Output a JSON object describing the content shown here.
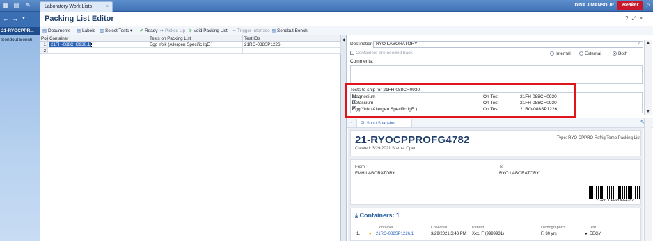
{
  "window": {
    "tab_title": "Laboratory Work Lists",
    "user": "DINA J MANSOUR",
    "brand": "Beaker"
  },
  "sidebar": {
    "active_item": "21-RYOCPPR...",
    "items": [
      "Sendout Bench"
    ]
  },
  "header": {
    "title": "Packing List Editor"
  },
  "toolbar": {
    "items": [
      "Documents",
      "Labels",
      "Select Tests",
      "Ready",
      "Picked Up",
      "Void Packing List",
      "Trigger Interface",
      "Sendout Bench"
    ]
  },
  "grid": {
    "columns": [
      "Pos",
      "Container",
      "Tests on Packing List",
      "Test IDs"
    ],
    "rows": [
      {
        "pos": "1",
        "container": "21FH-088CH0930.1",
        "tests": "Egg Yolk (Allergen Specific IgE )",
        "test_ids": "21RO-088SP1226"
      },
      {
        "pos": "2",
        "container": "",
        "tests": "",
        "test_ids": ""
      }
    ]
  },
  "destination": {
    "label": "Destination:",
    "value": "RYO LABORATORY",
    "containers_needed_back": "Containers are needed back",
    "radio_options": [
      "Internal",
      "External",
      "Both"
    ],
    "selected": "Both",
    "comments_label": "Comments:"
  },
  "tests_to_ship": {
    "title": "Tests to ship for 21FH-088CH0930",
    "rows": [
      {
        "name": "Magnesium",
        "status": "On Test",
        "id": "21FH-088CH0930",
        "checked": false
      },
      {
        "name": "Potassium",
        "status": "On Test",
        "id": "21FH-088CH0930",
        "checked": false
      },
      {
        "name": "Egg Yolk (Allergen Specific IgE )",
        "status": "On Test",
        "id": "21RO-088SP1226",
        "checked": true
      }
    ]
  },
  "snapshot": {
    "tab": "PL Short Snapshot",
    "id": "21-RYOCPPROFG4782",
    "created": "Created: 3/29/2021  Status: Open",
    "type": "Type: RYO CPPRO Refrig Temp Packing List",
    "from_label": "From",
    "from_value": "FMH LABORATORY",
    "to_label": "To",
    "to_value": "RYO LABORATORY",
    "barcode_text": "21-RYOCPPROFG4782",
    "containers_header": "Containers: 1",
    "container_cols": [
      "Container",
      "Collected",
      "Patient",
      "Demographics",
      "Test"
    ],
    "container_row": {
      "num": "1.",
      "container": "21RO-088SP1226.1",
      "collected": "3/29/2021 3:43 PM",
      "patient": "Xxx, F (9999931)",
      "demographics": "F, 30 yrs",
      "test": "EEGY"
    }
  }
}
